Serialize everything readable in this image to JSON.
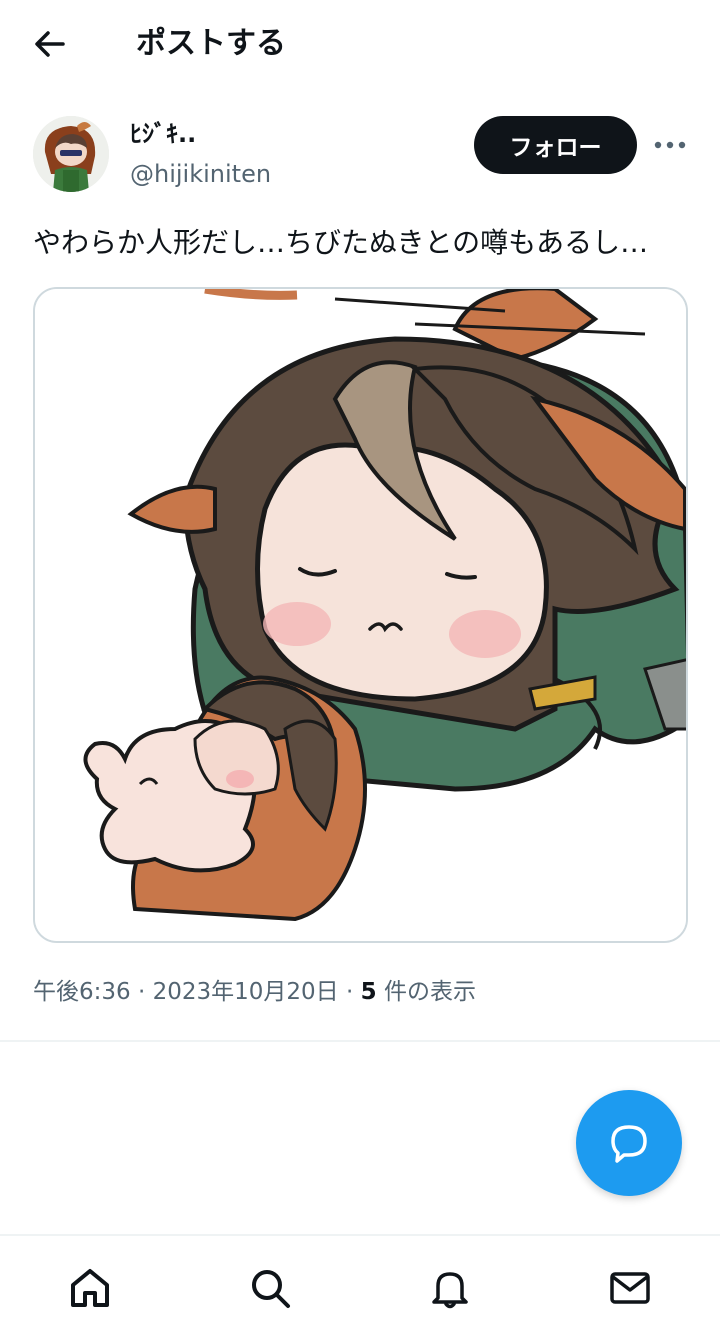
{
  "header": {
    "title": "ポストする",
    "back_icon": "arrow-left-icon"
  },
  "author": {
    "display_name": "ﾋｼﾞｷ..",
    "handle": "@hijikiniten",
    "follow_label": "フォロー",
    "more_icon": "more-horizontal-icon"
  },
  "post": {
    "text": "やわらか人形だし…ちびたぬきとの噂もあるし…",
    "media": "illustration"
  },
  "meta": {
    "time": "午後6:36",
    "date": "2023年10月20日",
    "views_count": "5",
    "views_label": "件の表示"
  },
  "fab": {
    "icon": "reply-icon",
    "color": "#1d9bf0"
  },
  "nav": {
    "items": [
      {
        "icon": "home-icon"
      },
      {
        "icon": "search-icon"
      },
      {
        "icon": "bell-icon"
      },
      {
        "icon": "mail-icon"
      }
    ]
  },
  "colors": {
    "text_primary": "#0f1419",
    "text_secondary": "#536471",
    "accent": "#1d9bf0",
    "border": "#cfd9de"
  }
}
